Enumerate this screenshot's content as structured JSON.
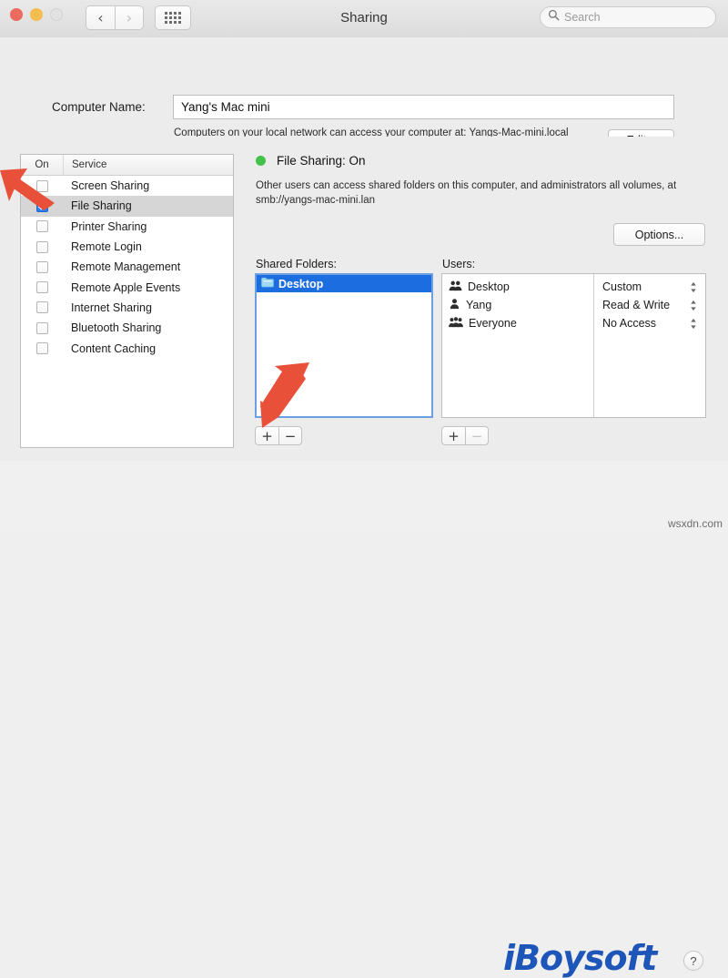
{
  "window": {
    "title": "Sharing",
    "traffic_lights": [
      "close",
      "minimize",
      "zoom-disabled"
    ],
    "nav": {
      "back": "‹",
      "forward": "›",
      "grid": "show-all"
    },
    "search": {
      "placeholder": "Search",
      "value": ""
    }
  },
  "computer_name": {
    "label": "Computer Name:",
    "value": "Yang's Mac mini",
    "description": "Computers on your local network can access your computer at: Yangs-Mac-mini.local",
    "edit_button": "Edit..."
  },
  "services": {
    "columns": {
      "on": "On",
      "service": "Service"
    },
    "rows": [
      {
        "name": "Screen Sharing",
        "checked": false,
        "selected": false
      },
      {
        "name": "File Sharing",
        "checked": true,
        "selected": true
      },
      {
        "name": "Printer Sharing",
        "checked": false,
        "selected": false
      },
      {
        "name": "Remote Login",
        "checked": false,
        "selected": false
      },
      {
        "name": "Remote Management",
        "checked": false,
        "selected": false
      },
      {
        "name": "Remote Apple Events",
        "checked": false,
        "selected": false
      },
      {
        "name": "Internet Sharing",
        "checked": false,
        "selected": false
      },
      {
        "name": "Bluetooth Sharing",
        "checked": false,
        "selected": false
      },
      {
        "name": "Content Caching",
        "checked": false,
        "selected": false
      }
    ]
  },
  "detail": {
    "status": "File Sharing: On",
    "status_color": "#43c14a",
    "description": "Other users can access shared folders on this computer, and administrators all volumes, at smb://yangs-mac-mini.lan",
    "options_button": "Options..."
  },
  "shared_folders": {
    "label": "Shared Folders:",
    "items": [
      {
        "name": "Desktop",
        "selected": true
      }
    ],
    "add_button": "+",
    "remove_button": "−"
  },
  "users": {
    "label": "Users:",
    "rows": [
      {
        "name": "Desktop",
        "icon": "two-people-icon",
        "permission": "Custom"
      },
      {
        "name": "Yang",
        "icon": "single-person-icon",
        "permission": "Read & Write"
      },
      {
        "name": "Everyone",
        "icon": "group-people-icon",
        "permission": "No Access"
      }
    ],
    "add_button": "+",
    "remove_button": "−",
    "remove_disabled": true
  },
  "footer": {
    "logo_text": "iBoysoft",
    "logo_color": "#1d55b8",
    "help_button": "?",
    "watermark": "wsxdn.com"
  },
  "annotations": {
    "arrow_color": "#e8503a",
    "arrow_checkbox_target": "File Sharing checkbox",
    "arrow_plus_target": "Shared Folders add button"
  }
}
